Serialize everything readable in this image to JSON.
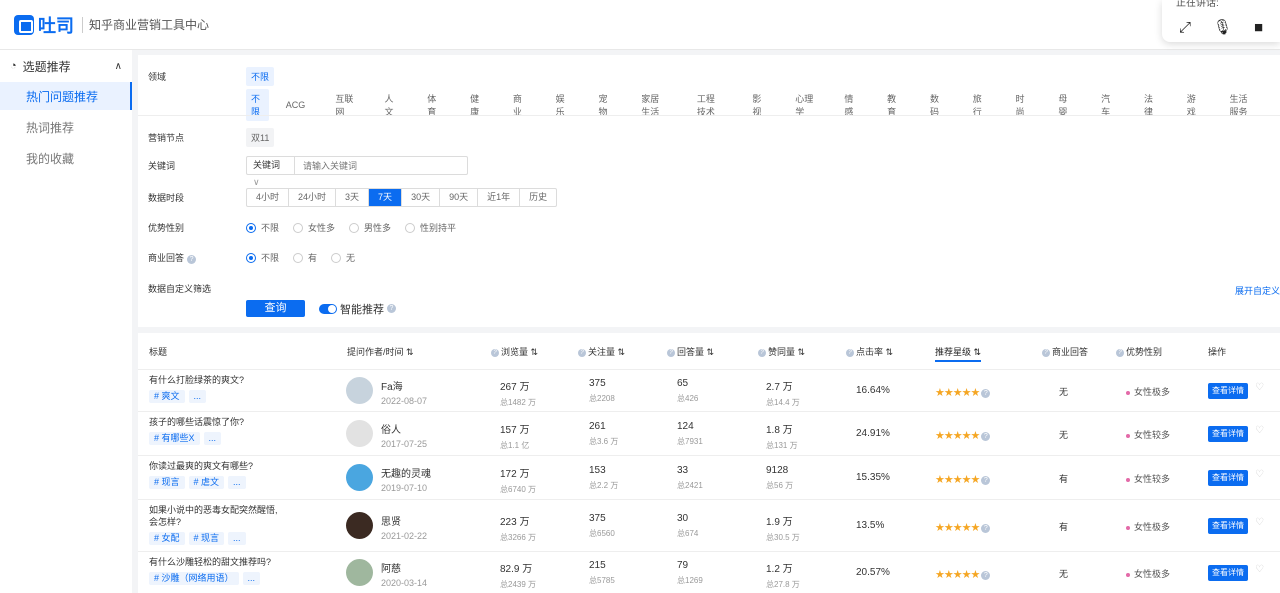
{
  "header": {
    "brand": "吐司",
    "subtitle": "知乎商业营销工具中心"
  },
  "float_panel": {
    "title": "正在讲话:"
  },
  "sidebar": {
    "section": "选题推荐",
    "items": [
      {
        "label": "热门问题推荐",
        "active": true
      },
      {
        "label": "热词推荐"
      },
      {
        "label": "我的收藏"
      }
    ]
  },
  "filters": {
    "domain": {
      "label": "领域",
      "first": "不限",
      "options": [
        "不限",
        "ACG",
        "互联网",
        "人文",
        "体育",
        "健康",
        "商业",
        "娱乐",
        "宠物",
        "家居生活",
        "工程技术",
        "影视",
        "心理学",
        "情感",
        "教育",
        "数码",
        "旅行",
        "时尚",
        "母婴",
        "汽车",
        "法律",
        "游戏",
        "生活服务"
      ]
    },
    "node": {
      "label": "营销节点",
      "value": "双11"
    },
    "keyword": {
      "label": "关键词",
      "select": "关键词",
      "placeholder": "请输入关键词"
    },
    "period": {
      "label": "数据时段",
      "options": [
        "4小时",
        "24小时",
        "3天",
        "7天",
        "30天",
        "90天",
        "近1年",
        "历史"
      ],
      "active": 3
    },
    "gender": {
      "label": "优势性别",
      "options": [
        "不限",
        "女性多",
        "男性多",
        "性别持平"
      ]
    },
    "business": {
      "label": "商业回答",
      "options": [
        "不限",
        "有",
        "无"
      ]
    },
    "custom": {
      "label": "数据自定义筛选",
      "expand": "展开自定义"
    },
    "query": "查询",
    "smart": "智能推荐"
  },
  "table": {
    "headers": {
      "title": "标题",
      "author": "提问作者/时间 ⇅",
      "views": "浏览量 ⇅",
      "follows": "关注量 ⇅",
      "answers": "回答量 ⇅",
      "likes": "赞同量 ⇅",
      "ctr": "点击率 ⇅",
      "stars": "推荐星级 ⇅",
      "biz": "商业回答",
      "gender": "优势性别",
      "op": "操作"
    },
    "detail_label": "查看详情",
    "more_label": "...",
    "rows": [
      {
        "title1": "有什么打脸绿茶的爽文?",
        "title2": "",
        "tags": [
          "# 爽文"
        ],
        "author": "Fa海",
        "date": "2022-08-07",
        "avatar": "#c7d3dd",
        "views": "267 万",
        "views_total": "总1482 万",
        "follows": "375",
        "follows_total": "总2208",
        "answers": "65",
        "answers_total": "总426",
        "likes": "2.7 万",
        "likes_total": "总14.4 万",
        "ctr": "16.64%",
        "stars": "★★★★★",
        "biz": "无",
        "gender": "女性极多"
      },
      {
        "title1": "孩子的哪些话震惊了你?",
        "title2": "",
        "tags": [
          "# 有哪些X"
        ],
        "author": "俗人",
        "date": "2017-07-25",
        "avatar": "#e2e2e2",
        "views": "157 万",
        "views_total": "总1.1 亿",
        "follows": "261",
        "follows_total": "总3.6 万",
        "answers": "124",
        "answers_total": "总7931",
        "likes": "1.8 万",
        "likes_total": "总131 万",
        "ctr": "24.91%",
        "stars": "★★★★★",
        "biz": "无",
        "gender": "女性较多"
      },
      {
        "title1": "你读过最爽的爽文有哪些?",
        "title2": "",
        "tags": [
          "# 现言",
          "# 虐文"
        ],
        "author": "无趣的灵魂",
        "date": "2019-07-10",
        "avatar": "#4aa6e0",
        "views": "172 万",
        "views_total": "总6740 万",
        "follows": "153",
        "follows_total": "总2.2 万",
        "answers": "33",
        "answers_total": "总2421",
        "likes": "9128",
        "likes_total": "总56 万",
        "ctr": "15.35%",
        "stars": "★★★★★",
        "biz": "有",
        "gender": "女性较多"
      },
      {
        "title1": "如果小说中的恶毒女配突然醒悟,",
        "title2": "会怎样?",
        "tags": [
          "# 女配",
          "# 现言"
        ],
        "author": "思贤",
        "date": "2021-02-22",
        "avatar": "#3b2a22",
        "views": "223 万",
        "views_total": "总3266 万",
        "follows": "375",
        "follows_total": "总6560",
        "answers": "30",
        "answers_total": "总674",
        "likes": "1.9 万",
        "likes_total": "总30.5 万",
        "ctr": "13.5%",
        "stars": "★★★★★",
        "biz": "有",
        "gender": "女性极多"
      },
      {
        "title1": "有什么沙雕轻松的甜文推荐吗?",
        "title2": "",
        "tags": [
          "# 沙雕（网络用语）"
        ],
        "author": "阿慈",
        "date": "2020-03-14",
        "avatar": "#9fb79e",
        "views": "82.9 万",
        "views_total": "总2439 万",
        "follows": "215",
        "follows_total": "总5785",
        "answers": "79",
        "answers_total": "总1269",
        "likes": "1.2 万",
        "likes_total": "总27.8 万",
        "ctr": "20.57%",
        "stars": "★★★★★",
        "biz": "无",
        "gender": "女性极多"
      }
    ]
  }
}
